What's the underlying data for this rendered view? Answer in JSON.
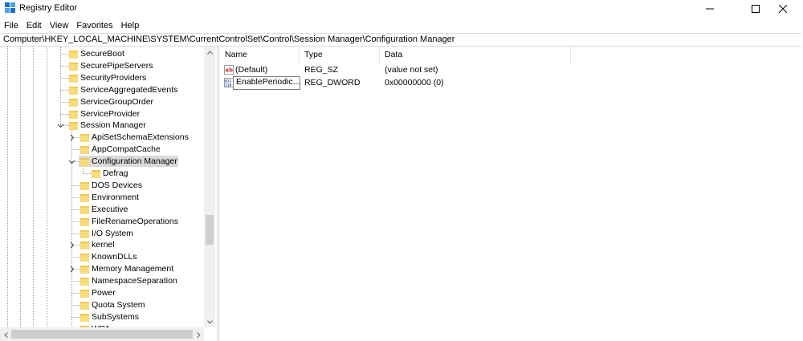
{
  "window": {
    "title": "Registry Editor"
  },
  "menu": [
    "File",
    "Edit",
    "View",
    "Favorites",
    "Help"
  ],
  "address": "Computer\\HKEY_LOCAL_MACHINE\\SYSTEM\\CurrentControlSet\\Control\\Session Manager\\Configuration Manager",
  "tree": {
    "items": [
      {
        "label": "SecureBoot",
        "has_children": false
      },
      {
        "label": "SecurePipeServers",
        "has_children": false
      },
      {
        "label": "SecurityProviders",
        "has_children": false
      },
      {
        "label": "ServiceAggregatedEvents",
        "has_children": false
      },
      {
        "label": "ServiceGroupOrder",
        "has_children": false
      },
      {
        "label": "ServiceProvider",
        "has_children": false
      },
      {
        "label": "Session Manager",
        "expanded": true
      },
      {
        "label": "ApiSetSchemaExtensions",
        "has_children": true
      },
      {
        "label": "AppCompatCache",
        "has_children": false
      },
      {
        "label": "Configuration Manager",
        "expanded": true,
        "selected": true
      },
      {
        "label": "Defrag",
        "has_children": false
      },
      {
        "label": "DOS Devices",
        "has_children": false
      },
      {
        "label": "Environment",
        "has_children": false
      },
      {
        "label": "Executive",
        "has_children": false
      },
      {
        "label": "FileRenameOperations",
        "has_children": false
      },
      {
        "label": "I/O System",
        "has_children": false
      },
      {
        "label": "kernel",
        "has_children": true
      },
      {
        "label": "KnownDLLs",
        "has_children": false
      },
      {
        "label": "Memory Management",
        "has_children": true
      },
      {
        "label": "NamespaceSeparation",
        "has_children": false
      },
      {
        "label": "Power",
        "has_children": false
      },
      {
        "label": "Quota System",
        "has_children": false
      },
      {
        "label": "SubSystems",
        "has_children": false
      },
      {
        "label": "WPA",
        "has_children": false
      }
    ]
  },
  "list": {
    "columns": [
      "Name",
      "Type",
      "Data"
    ],
    "rows": [
      {
        "name": "(Default)",
        "type": "REG_SZ",
        "data": "(value not set)",
        "icon": "string-value-icon"
      },
      {
        "name": "EnablePeriodic...",
        "type": "REG_DWORD",
        "data": "0x00000000 (0)",
        "icon": "binary-value-icon",
        "editing": true
      }
    ]
  },
  "colors": {
    "folder": "#f2c94c",
    "selection": "#d9d9d9",
    "scrollbar_thumb": "#cdcdcd"
  }
}
